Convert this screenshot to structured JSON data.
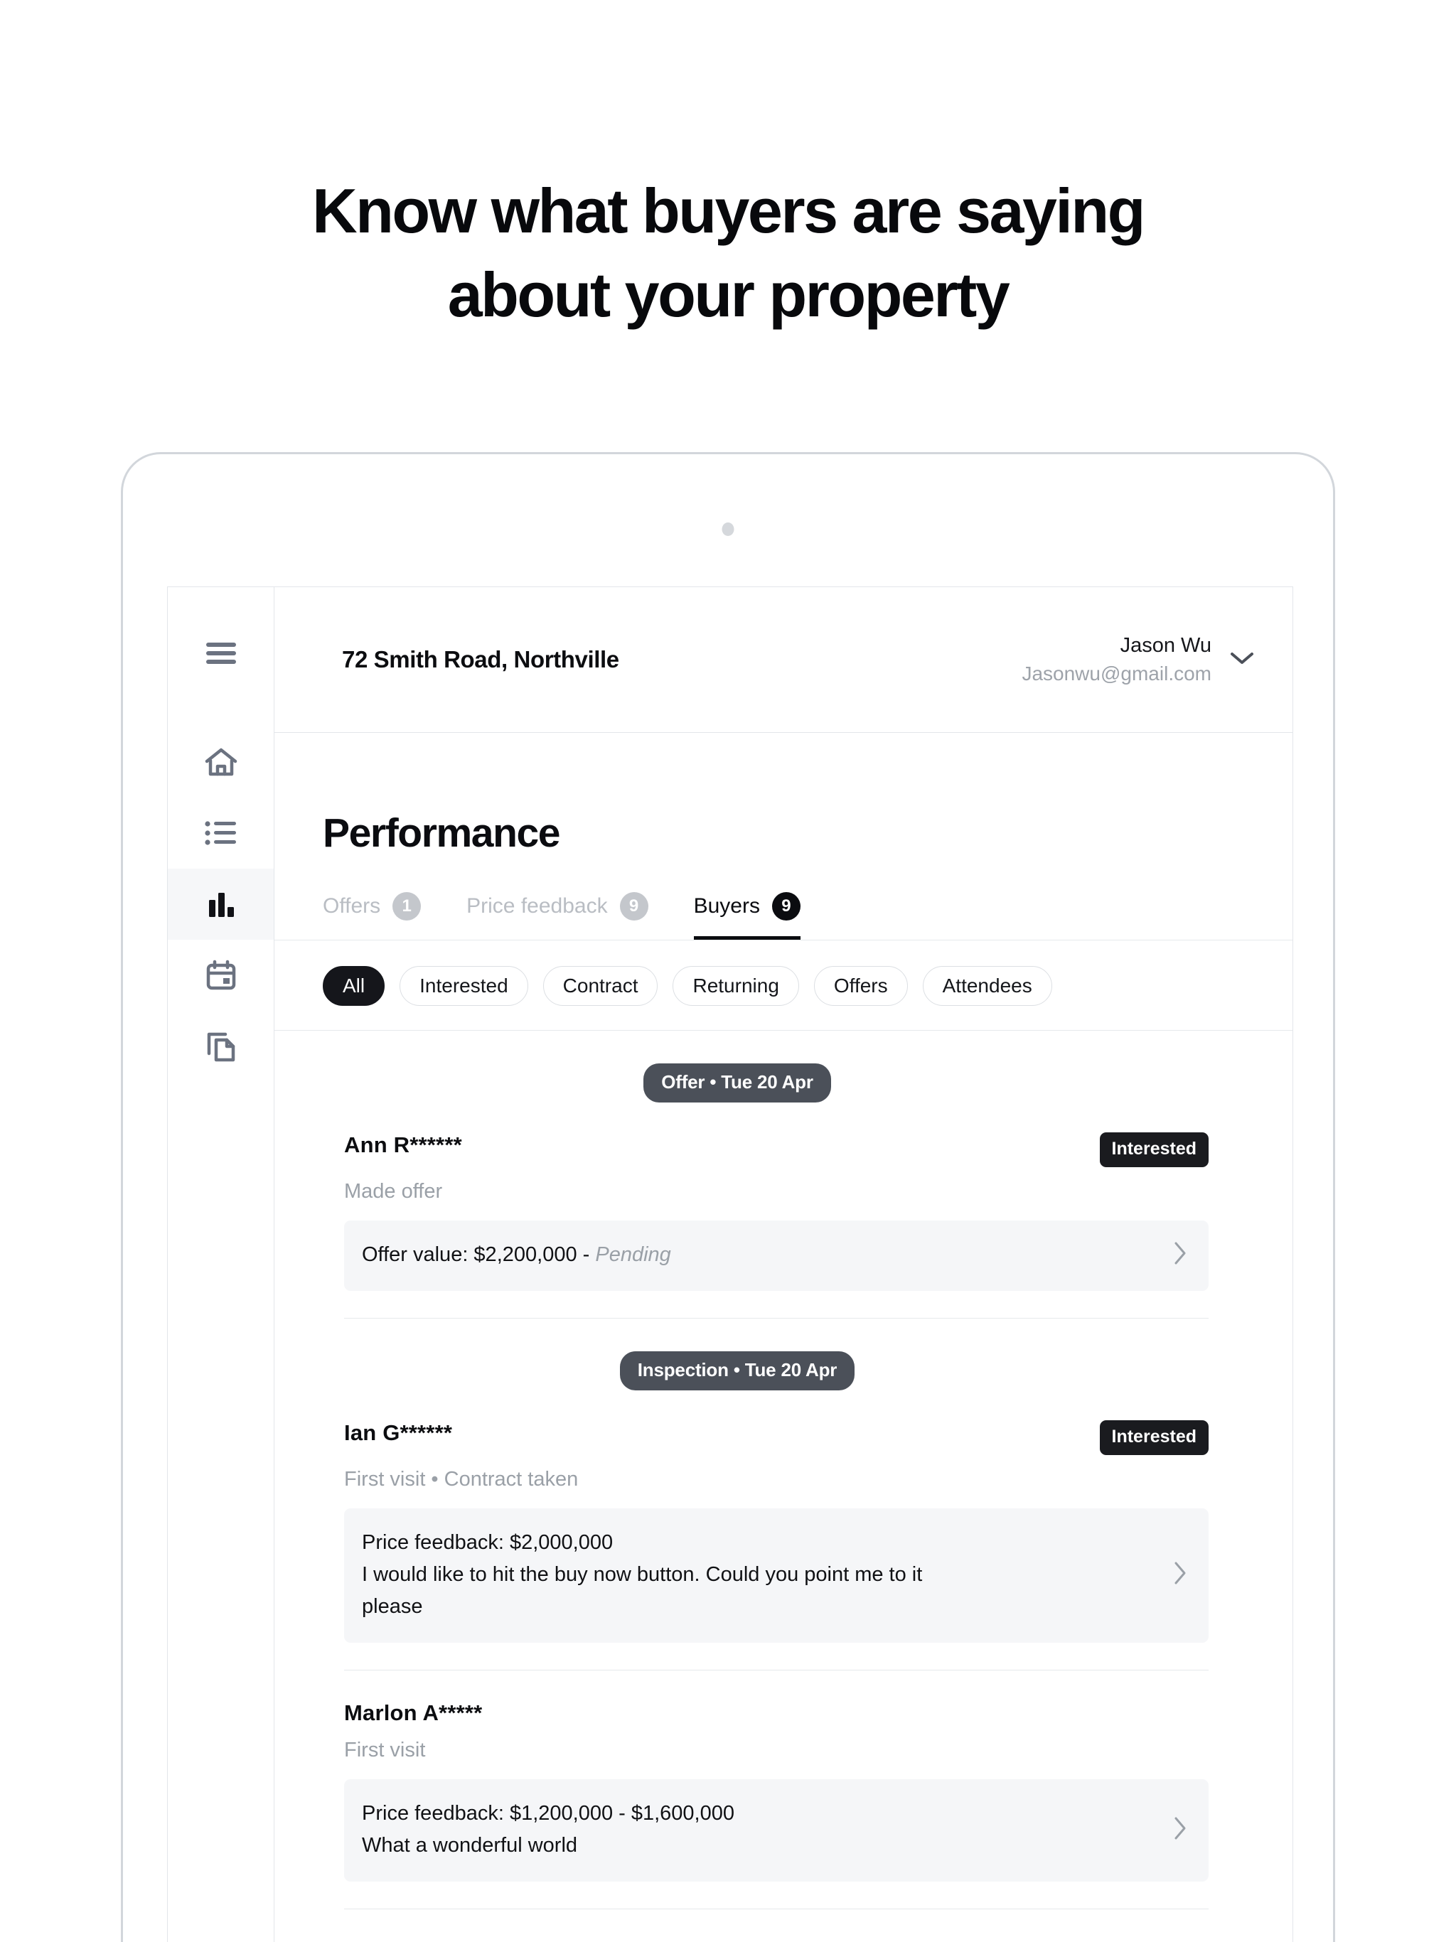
{
  "headline": {
    "line1": "Know what buyers are saying",
    "line2": "about your property"
  },
  "device": {
    "camera_icon": "camera-dot"
  },
  "sidebar": {
    "items": [
      {
        "icon": "hamburger-menu-icon",
        "name": "menu",
        "active": false
      },
      {
        "icon": "home-icon",
        "name": "home",
        "active": false
      },
      {
        "icon": "list-icon",
        "name": "listings",
        "active": false
      },
      {
        "icon": "bar-chart-icon",
        "name": "performance",
        "active": true
      },
      {
        "icon": "calendar-icon",
        "name": "calendar",
        "active": false
      },
      {
        "icon": "documents-icon",
        "name": "documents",
        "active": false
      }
    ]
  },
  "topbar": {
    "property_title": "72 Smith Road, Northville",
    "user_name": "Jason Wu",
    "user_email": "Jasonwu@gmail.com",
    "chevron_icon": "chevron-down-icon"
  },
  "main": {
    "page_title": "Performance",
    "tabs": [
      {
        "label": "Offers",
        "count": "1",
        "active": false
      },
      {
        "label": "Price feedback",
        "count": "9",
        "active": false
      },
      {
        "label": "Buyers",
        "count": "9",
        "active": true
      }
    ],
    "filters": [
      {
        "label": "All",
        "active": true
      },
      {
        "label": "Interested",
        "active": false
      },
      {
        "label": "Contract",
        "active": false
      },
      {
        "label": "Returning",
        "active": false
      },
      {
        "label": "Offers",
        "active": false
      },
      {
        "label": "Attendees",
        "active": false
      }
    ],
    "groups": [
      {
        "date_pill": "Offer • Tue 20 Apr",
        "entries": [
          {
            "name": "Ann R******",
            "status": "Interested",
            "subtitle": "Made offer",
            "detail_line1": "Offer value: $2,200,000 - ",
            "detail_line1_italic": "Pending",
            "detail_line2": "",
            "detail_line3": "",
            "chevron_icon": "chevron-right-icon"
          }
        ]
      },
      {
        "date_pill": "Inspection • Tue 20 Apr",
        "entries": [
          {
            "name": "Ian G******",
            "status": "Interested",
            "subtitle": "First visit • Contract taken",
            "detail_line1": "Price feedback: $2,000,000",
            "detail_line1_italic": "",
            "detail_line2": "I would like to hit the buy now button. Could you point me to it",
            "detail_line3": "please",
            "chevron_icon": "chevron-right-icon"
          },
          {
            "name": "Marlon A*****",
            "status": "",
            "subtitle": "First visit",
            "detail_line1": "Price feedback: $1,200,000 - $1,600,000",
            "detail_line1_italic": "",
            "detail_line2": "What a wonderful world",
            "detail_line3": "",
            "chevron_icon": "chevron-right-icon"
          }
        ]
      }
    ]
  },
  "colors": {
    "accent_dark": "#15161b",
    "badge_grey": "#c4c7cc",
    "pill_grey": "#4b5059",
    "panel_grey": "#f5f6f8",
    "muted_text": "#9aa0a7",
    "border": "#e3e6ea"
  }
}
